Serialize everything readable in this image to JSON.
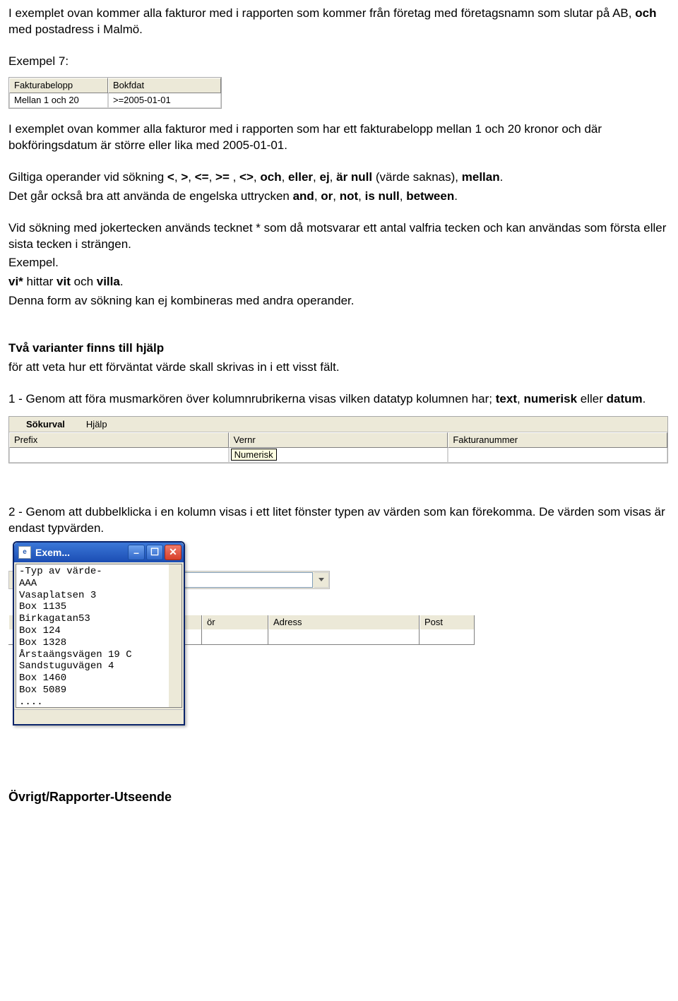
{
  "intro1a": "I exemplet ovan kommer alla fakturor med i rapporten som kommer från företag med företagsnamn som slutar på AB, ",
  "intro1b": "och",
  "intro1c": " med postadress i Malmö.",
  "ex7_label": "Exempel 7:",
  "table1": {
    "headers": [
      "Fakturabelopp",
      "Bokfdat"
    ],
    "row": [
      "Mellan 1 och 20",
      ">=2005-01-01"
    ]
  },
  "para2": "I exemplet ovan kommer alla fakturor med i rapporten som har ett fakturabelopp mellan 1 och 20 kronor och där bokföringsdatum är större eller lika med 2005-01-01.",
  "para3_parts": [
    "Giltiga operander vid sökning ",
    "<",
    ", ",
    ">",
    ", ",
    "<=",
    ", ",
    ">=",
    " , ",
    "<>",
    ", ",
    "och",
    ", ",
    "eller",
    ", ",
    "ej",
    ", ",
    "är null",
    " (värde saknas), ",
    "mellan",
    "."
  ],
  "para3b_parts": [
    "Det går också bra att använda de engelska uttrycken ",
    "and",
    ", ",
    "or",
    ", ",
    "not",
    ", ",
    "is null",
    ", ",
    "between",
    "."
  ],
  "para4": "Vid sökning med jokertecken används tecknet * som då motsvarar ett antal valfria tecken och kan användas som första eller sista tecken i strängen.",
  "para4b": "Exempel.",
  "para4c_parts": [
    "vi*",
    " hittar ",
    "vit",
    " och ",
    "villa",
    "."
  ],
  "para4d": "Denna form av sökning kan ej kombineras med andra operander.",
  "hlp_title": "Två varianter finns till hjälp",
  "hlp_sub": "för att veta hur ett förväntat värde skall skrivas in i ett visst fält.",
  "hlp1_parts": [
    "1 - Genom att föra musmarkören över kolumnrubrikerna visas vilken datatyp kolumnen har; ",
    "text",
    ", ",
    "numerisk",
    " eller ",
    "datum",
    "."
  ],
  "grid2": {
    "menu": [
      "Sökurval",
      "Hjälp"
    ],
    "headers": [
      "Prefix",
      "Vernr",
      "Fakturanummer"
    ],
    "tooltip": "Numerisk"
  },
  "hlp2": "2 - Genom att dubbelklicka i en kolumn visas i ett litet fönster typen av värden som kan förekomma. De värden som visas är endast typvärden.",
  "popup": {
    "title": "Exem...",
    "list": [
      "-Typ av värde-",
      "AAA",
      "Vasaplatsen 3",
      "Box 1135",
      "Birkagatan53",
      "Box 124",
      "Box 1328",
      "Årstaängsvägen 19 C",
      "Sandstuguvägen 4",
      "Box 1460",
      "Box 5089",
      "...."
    ]
  },
  "back_cols": {
    "a": "ör",
    "b": "Adress",
    "c": "Post"
  },
  "footer": "Övrigt/Rapporter-Utseende"
}
